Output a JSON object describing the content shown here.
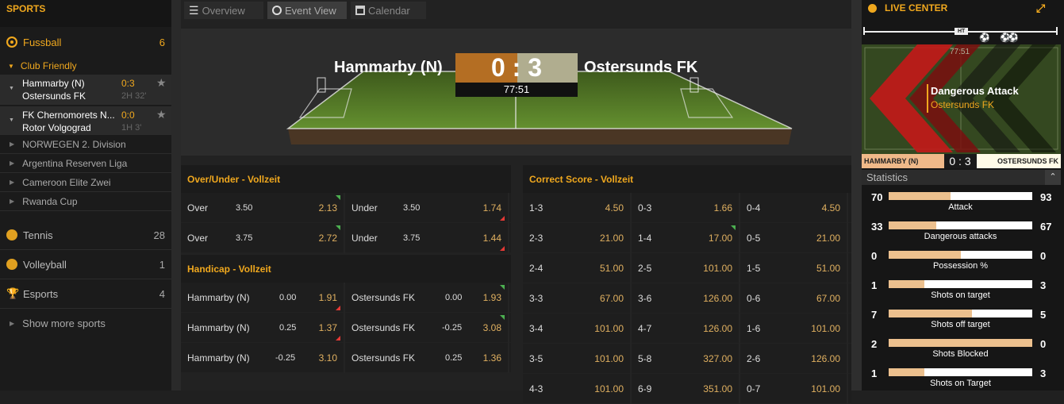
{
  "sidebar": {
    "title": "SPORTS",
    "active_sport": {
      "name": "Fussball",
      "count": "6"
    },
    "league": "Club Friendly",
    "matches": [
      {
        "home": "Hammarby (N)",
        "away": "Ostersunds FK",
        "score": "0:3",
        "time": "2H 32'"
      },
      {
        "home": "FK Chernomorets N...",
        "away": "Rotor Volgograd",
        "score": "0:0",
        "time": "1H 3'"
      }
    ],
    "categories": [
      "NORWEGEN 2. Division",
      "Argentina Reserven Liga",
      "Cameroon Elite Zwei",
      "Rwanda Cup"
    ],
    "sports": [
      {
        "name": "Tennis",
        "count": "28",
        "color": "#e0a020"
      },
      {
        "name": "Volleyball",
        "count": "1",
        "color": "#e0a020"
      },
      {
        "name": "Esports",
        "count": "4",
        "color": "#e0a020"
      }
    ],
    "more": "Show more sports"
  },
  "tabs": [
    "Overview",
    "Event View",
    "Calendar"
  ],
  "event": {
    "home": "Hammarby (N)",
    "away": "Ostersunds FK",
    "score": "0 : 3",
    "clock": "77:51"
  },
  "over_under": {
    "title": "Over/Under - Vollzeit",
    "rows": [
      {
        "over": "Over",
        "oline": "3.50",
        "oodds": "2.13",
        "under": "Under",
        "uline": "3.50",
        "uodds": "1.74"
      },
      {
        "over": "Over",
        "oline": "3.75",
        "oodds": "2.72",
        "under": "Under",
        "uline": "3.75",
        "uodds": "1.44"
      }
    ]
  },
  "handicap": {
    "title": "Handicap - Vollzeit",
    "rows": [
      {
        "home": "Hammarby (N)",
        "hline": "0.00",
        "hodds": "1.91",
        "away": "Ostersunds FK",
        "aline": "0.00",
        "aodds": "1.93"
      },
      {
        "home": "Hammarby (N)",
        "hline": "0.25",
        "hodds": "1.37",
        "away": "Ostersunds FK",
        "aline": "-0.25",
        "aodds": "3.08"
      },
      {
        "home": "Hammarby (N)",
        "hline": "-0.25",
        "hodds": "3.10",
        "away": "Ostersunds FK",
        "aline": "0.25",
        "aodds": "1.36"
      }
    ]
  },
  "correct_score": {
    "title": "Correct Score - Vollzeit",
    "rows": [
      [
        [
          "1-3",
          "4.50"
        ],
        [
          "0-3",
          "1.66"
        ],
        [
          "0-4",
          "4.50"
        ]
      ],
      [
        [
          "2-3",
          "21.00"
        ],
        [
          "1-4",
          "17.00"
        ],
        [
          "0-5",
          "21.00"
        ]
      ],
      [
        [
          "2-4",
          "51.00"
        ],
        [
          "2-5",
          "101.00"
        ],
        [
          "1-5",
          "51.00"
        ]
      ],
      [
        [
          "3-3",
          "67.00"
        ],
        [
          "3-6",
          "126.00"
        ],
        [
          "0-6",
          "67.00"
        ]
      ],
      [
        [
          "3-4",
          "101.00"
        ],
        [
          "4-7",
          "126.00"
        ],
        [
          "1-6",
          "101.00"
        ]
      ],
      [
        [
          "3-5",
          "101.00"
        ],
        [
          "5-8",
          "327.00"
        ],
        [
          "2-6",
          "126.00"
        ]
      ],
      [
        [
          "4-3",
          "101.00"
        ],
        [
          "6-9",
          "351.00"
        ],
        [
          "0-7",
          "101.00"
        ]
      ]
    ]
  },
  "live_center": {
    "title": "LIVE CENTER",
    "ht_label": "HT",
    "mini_clock": "77:51",
    "event_title": "Dangerous Attack",
    "event_team": "Ostersunds FK",
    "home": "HAMMARBY (N)",
    "away": "OSTERSUNDS FK",
    "score": "0 : 3",
    "stats_title": "Statistics",
    "stats": [
      {
        "label": "Attack",
        "home": "70",
        "away": "93",
        "share": 0.43
      },
      {
        "label": "Dangerous attacks",
        "home": "33",
        "away": "67",
        "share": 0.33
      },
      {
        "label": "Possession %",
        "home": "0",
        "away": "0",
        "share": 0.5
      },
      {
        "label": "Shots on target",
        "home": "1",
        "away": "3",
        "share": 0.25
      },
      {
        "label": "Shots off target",
        "home": "7",
        "away": "5",
        "share": 0.58
      },
      {
        "label": "Shots Blocked",
        "home": "2",
        "away": "0",
        "share": 1.0
      },
      {
        "label": "Shots on Target",
        "home": "1",
        "away": "3",
        "share": 0.25
      }
    ]
  }
}
